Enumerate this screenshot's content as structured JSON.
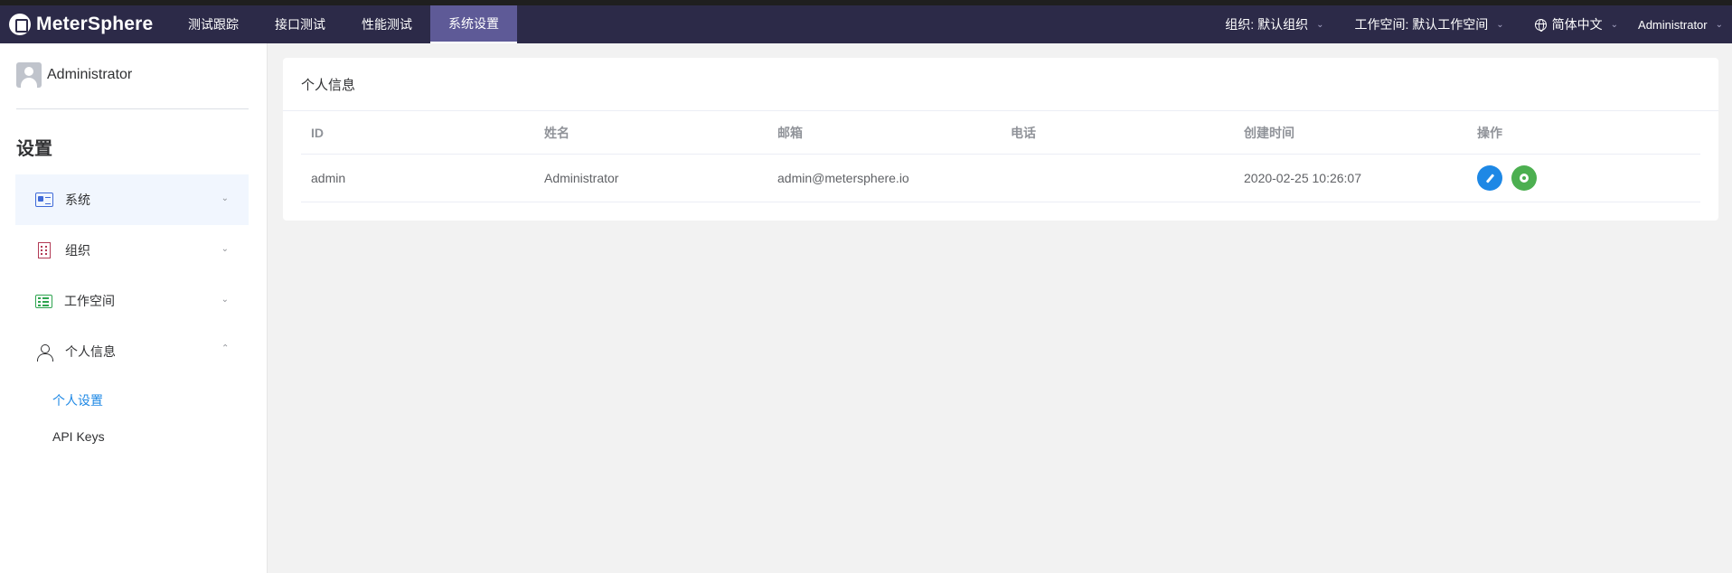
{
  "app": {
    "logo_text": "MeterSphere"
  },
  "topnav": {
    "items": [
      {
        "label": "测试跟踪"
      },
      {
        "label": "接口测试"
      },
      {
        "label": "性能测试"
      },
      {
        "label": "系统设置"
      }
    ],
    "active_index": 3
  },
  "topright": {
    "org": "组织: 默认组织",
    "workspace": "工作空间: 默认工作空间",
    "language": "简体中文",
    "user": "Administrator"
  },
  "sidebar": {
    "username": "Administrator",
    "title": "设置",
    "menu": [
      {
        "label": "系统",
        "icon": "system-icon",
        "expanded": false
      },
      {
        "label": "组织",
        "icon": "org-icon",
        "expanded": false
      },
      {
        "label": "工作空间",
        "icon": "workspace-icon",
        "expanded": false
      },
      {
        "label": "个人信息",
        "icon": "person-icon",
        "expanded": true
      }
    ],
    "submenu": [
      {
        "label": "个人设置",
        "active": true
      },
      {
        "label": "API Keys",
        "active": false
      }
    ]
  },
  "main": {
    "card_title": "个人信息",
    "table": {
      "headers": [
        "ID",
        "姓名",
        "邮箱",
        "电话",
        "创建时间",
        "操作"
      ],
      "rows": [
        {
          "id": "admin",
          "name": "Administrator",
          "email": "admin@metersphere.io",
          "phone": "",
          "created": "2020-02-25 10:26:07"
        }
      ]
    }
  },
  "colors": {
    "topbar": "#2c2a48",
    "nav_active": "#5e5a97",
    "accent": "#1e88e5",
    "success": "#4caf50"
  }
}
